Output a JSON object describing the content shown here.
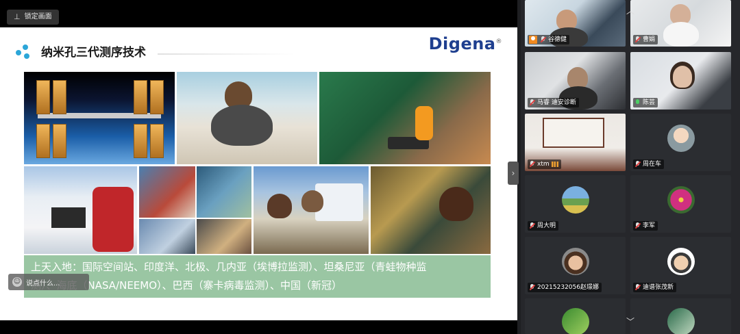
{
  "toolbar": {
    "pin_label": "锁定画面"
  },
  "slide": {
    "title": "纳米孔三代测序技术",
    "brand": "Digena",
    "brand_mark": "®",
    "caption_line1": "上天入地：国际空间站、印度洋、北极、几内亚（埃博拉监测）、坦桑尼亚（青蛙物种监",
    "caption_line2": "测）、海底（NASA/NEEMO）、巴西（寨卡病毒监测）、中国（新冠）"
  },
  "chat": {
    "placeholder": "说点什么..."
  },
  "participants": [
    {
      "name": "谷德健",
      "mic": "muted",
      "host": true
    },
    {
      "name": "曹娟",
      "mic": "muted",
      "host": false
    },
    {
      "name": "马睿 迪安诊断",
      "mic": "muted",
      "host": false
    },
    {
      "name": "陈芸",
      "mic": "on",
      "host": false
    },
    {
      "name": "xtm",
      "mic": "muted",
      "host": false,
      "signal": true
    },
    {
      "name": "周在车",
      "mic": "muted",
      "host": false
    },
    {
      "name": "周大明",
      "mic": "muted",
      "host": false
    },
    {
      "name": "李军",
      "mic": "muted",
      "host": false
    },
    {
      "name": "20215232056赵璟娜",
      "mic": "muted",
      "host": false
    },
    {
      "name": "迪谱张茂新",
      "mic": "muted",
      "host": false
    }
  ],
  "gallery_nav": {
    "up": "︿",
    "down": "﹀"
  },
  "collapse_glyph": "›",
  "icons": {
    "pin": "pin-icon",
    "chat": "smile-icon",
    "mic": "microphone-icon",
    "host": "host-icon"
  },
  "colors": {
    "caption_bg": "#8cbe96",
    "brand": "#1f3f8f",
    "mic_on": "#4ccf64",
    "mic_muted": "#e24040"
  }
}
